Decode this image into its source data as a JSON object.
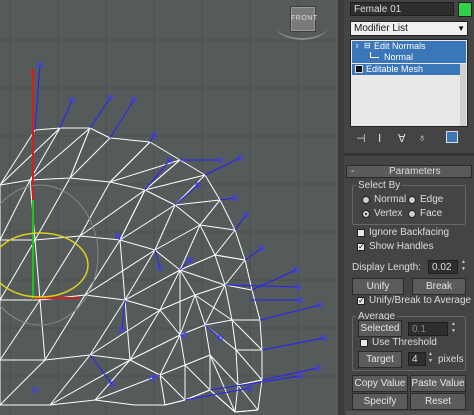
{
  "viewport": {
    "viewcube_label": "FRONT"
  },
  "object_name": "Female 01",
  "object_color": "#2fcf4a",
  "modifier_list": "Modifier List",
  "stack": [
    {
      "label": "Edit Normals",
      "sub": false,
      "selected": true
    },
    {
      "label": "Normal",
      "sub": true,
      "selected": true
    },
    {
      "label": "Editable Mesh",
      "sub": false,
      "selected": false
    }
  ],
  "parameters": {
    "title": "Parameters",
    "collapse": "-",
    "select_by": {
      "title": "Select By",
      "options": [
        "Normal",
        "Edge",
        "Vertex",
        "Face"
      ],
      "selected": "Vertex"
    },
    "ignore_backfacing": "Ignore Backfacing",
    "show_handles": "Show Handles",
    "display_length_label": "Display Length:",
    "display_length_value": "0.02",
    "unify": "Unify",
    "break": "Break",
    "unify_break_average": "Unify/Break to Average",
    "average": {
      "title": "Average",
      "selected": "Selected",
      "selected_value": "0.1",
      "use_threshold": "Use Threshold",
      "target": "Target",
      "target_value": "4",
      "pixels": "pixels"
    },
    "copy_value": "Copy Value",
    "paste_value": "Paste Value",
    "specify": "Specify",
    "reset": "Reset"
  },
  "colors": {
    "wire": "#ffffff",
    "normal_handle": "#1a1aff",
    "accent_blue": "#3b77b8",
    "gizmo_red": "#d02020",
    "gizmo_green": "#20c020",
    "gizmo_yellow": "#e0d020"
  }
}
